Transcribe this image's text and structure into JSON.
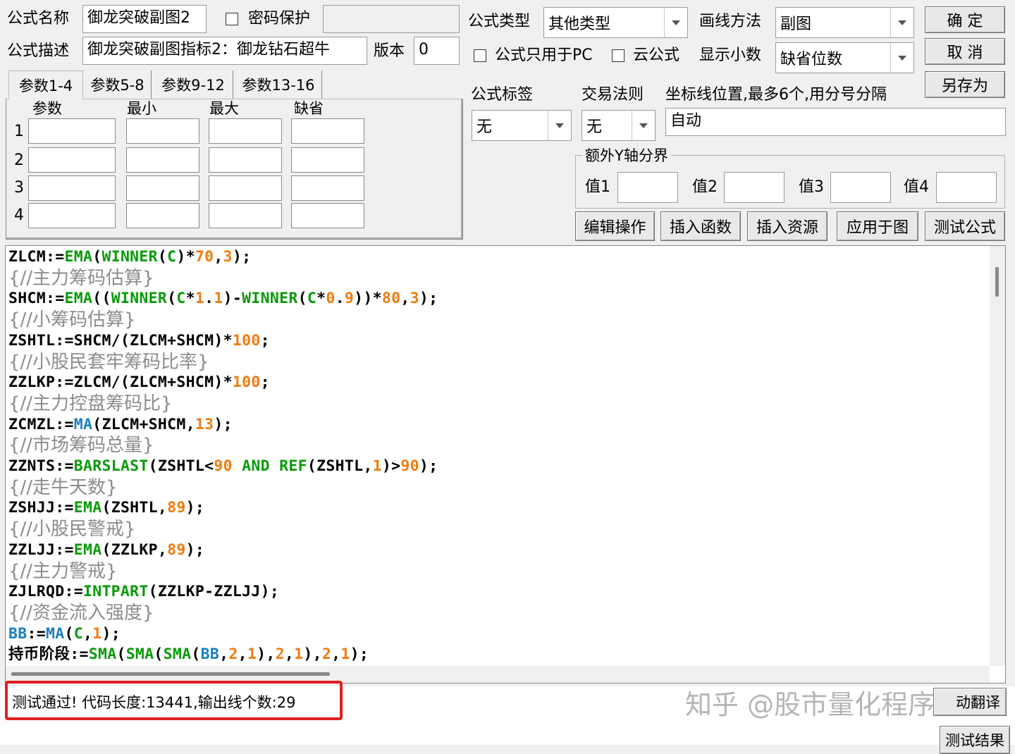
{
  "form": {
    "name_label": "公式名称",
    "name_value": "御龙突破副图2",
    "password_label": "密码保护",
    "desc_label": "公式描述",
    "desc_value": "御龙突破副图指标2：御龙钻石超牛",
    "version_label": "版本",
    "version_value": "0",
    "type_label": "公式类型",
    "type_value": "其他类型",
    "draw_label": "画线方法",
    "draw_value": "副图",
    "pc_only_label": "公式只用于PC",
    "cloud_label": "云公式",
    "decimal_label": "显示小数",
    "decimal_value": "缺省位数",
    "tag_label": "公式标签",
    "tag_value": "无",
    "trade_label": "交易法则",
    "trade_value": "无",
    "coord_label": "坐标线位置,最多6个,用分号分隔",
    "coord_value": "自动",
    "yaxis_group_label": "额外Y轴分界",
    "y_labels": [
      "值1",
      "值2",
      "值3",
      "值4"
    ]
  },
  "buttons": {
    "ok": "确  定",
    "cancel": "取  消",
    "save_as": "另存为",
    "edit_ops": "编辑操作",
    "insert_func": "插入函数",
    "insert_res": "插入资源",
    "apply_chart": "应用于图",
    "test_formula": "测试公式",
    "translate": "动翻译",
    "test_result": "测试结果"
  },
  "param_tabs": [
    "参数1-4",
    "参数5-8",
    "参数9-12",
    "参数13-16"
  ],
  "param_headers": [
    "参数",
    "最小",
    "最大",
    "缺省"
  ],
  "param_rows": [
    "1",
    "2",
    "3",
    "4"
  ],
  "code": [
    {
      "type": "code",
      "tokens": [
        [
          "id",
          "ZLCM:="
        ],
        [
          "fn",
          "EMA"
        ],
        [
          "op",
          "("
        ],
        [
          "fn",
          "WINNER"
        ],
        [
          "op",
          "("
        ],
        [
          "fn",
          "C"
        ],
        [
          "op",
          ")*"
        ],
        [
          "num",
          "70"
        ],
        [
          "op",
          ","
        ],
        [
          "num",
          "3"
        ],
        [
          "op",
          ");"
        ]
      ]
    },
    {
      "type": "comment",
      "text": "{//主力筹码估算}"
    },
    {
      "type": "code",
      "tokens": [
        [
          "id",
          "SHCM:="
        ],
        [
          "fn",
          "EMA"
        ],
        [
          "op",
          "(("
        ],
        [
          "fn",
          "WINNER"
        ],
        [
          "op",
          "("
        ],
        [
          "fn",
          "C"
        ],
        [
          "op",
          "*"
        ],
        [
          "num",
          "1"
        ],
        [
          "op",
          "."
        ],
        [
          "num",
          "1"
        ],
        [
          "op",
          ")-"
        ],
        [
          "fn",
          "WINNER"
        ],
        [
          "op",
          "("
        ],
        [
          "fn",
          "C"
        ],
        [
          "op",
          "*"
        ],
        [
          "num",
          "0"
        ],
        [
          "op",
          "."
        ],
        [
          "num",
          "9"
        ],
        [
          "op",
          "))*"
        ],
        [
          "num",
          "80"
        ],
        [
          "op",
          ","
        ],
        [
          "num",
          "3"
        ],
        [
          "op",
          ");"
        ]
      ]
    },
    {
      "type": "comment",
      "text": "{//小筹码估算}"
    },
    {
      "type": "code",
      "tokens": [
        [
          "id",
          "ZSHTL:=SHCM/(ZLCM+SHCM)*"
        ],
        [
          "num",
          "100"
        ],
        [
          "op",
          ";"
        ]
      ]
    },
    {
      "type": "comment",
      "text": "{//小股民套牢筹码比率}"
    },
    {
      "type": "code",
      "tokens": [
        [
          "id",
          "ZZLKP:=ZLCM/(ZLCM+SHCM)*"
        ],
        [
          "num",
          "100"
        ],
        [
          "op",
          ";"
        ]
      ]
    },
    {
      "type": "comment",
      "text": "{//主力控盘筹码比}"
    },
    {
      "type": "code",
      "tokens": [
        [
          "id",
          "ZCMZL:="
        ],
        [
          "fnb",
          "MA"
        ],
        [
          "op",
          "(ZLCM+SHCM,"
        ],
        [
          "num",
          "13"
        ],
        [
          "op",
          ");"
        ]
      ]
    },
    {
      "type": "comment",
      "text": "{//市场筹码总量}"
    },
    {
      "type": "code",
      "tokens": [
        [
          "id",
          "ZZNTS:="
        ],
        [
          "fn",
          "BARSLAST"
        ],
        [
          "op",
          "(ZSHTL<"
        ],
        [
          "num",
          "90"
        ],
        [
          "op",
          " "
        ],
        [
          "kw",
          "AND"
        ],
        [
          "op",
          " "
        ],
        [
          "fn",
          "REF"
        ],
        [
          "op",
          "(ZSHTL,"
        ],
        [
          "num",
          "1"
        ],
        [
          "op",
          ")>"
        ],
        [
          "num",
          "90"
        ],
        [
          "op",
          ");"
        ]
      ]
    },
    {
      "type": "comment",
      "text": "{//走牛天数}"
    },
    {
      "type": "code",
      "tokens": [
        [
          "id",
          "ZSHJJ:="
        ],
        [
          "fn",
          "EMA"
        ],
        [
          "op",
          "(ZSHTL,"
        ],
        [
          "num",
          "89"
        ],
        [
          "op",
          ");"
        ]
      ]
    },
    {
      "type": "comment",
      "text": "{//小股民警戒}"
    },
    {
      "type": "code",
      "tokens": [
        [
          "id",
          "ZZLJJ:="
        ],
        [
          "fn",
          "EMA"
        ],
        [
          "op",
          "(ZZLKP,"
        ],
        [
          "num",
          "89"
        ],
        [
          "op",
          ");"
        ]
      ]
    },
    {
      "type": "comment",
      "text": "{//主力警戒}"
    },
    {
      "type": "code",
      "tokens": [
        [
          "id",
          "ZJLRQD:="
        ],
        [
          "fn",
          "INTPART"
        ],
        [
          "op",
          "(ZZLKP-ZZLJJ);"
        ]
      ]
    },
    {
      "type": "comment",
      "text": "{//资金流入强度}"
    },
    {
      "type": "code",
      "tokens": [
        [
          "var",
          "BB"
        ],
        [
          "op",
          ":="
        ],
        [
          "fnb",
          "MA"
        ],
        [
          "op",
          "("
        ],
        [
          "fn",
          "C"
        ],
        [
          "op",
          ","
        ],
        [
          "num",
          "1"
        ],
        [
          "op",
          ");"
        ]
      ]
    },
    {
      "type": "code",
      "tokens": [
        [
          "id",
          "持币阶段:="
        ],
        [
          "fn",
          "SMA"
        ],
        [
          "op",
          "("
        ],
        [
          "fn",
          "SMA"
        ],
        [
          "op",
          "("
        ],
        [
          "fn",
          "SMA"
        ],
        [
          "op",
          "("
        ],
        [
          "var",
          "BB"
        ],
        [
          "op",
          ","
        ],
        [
          "num",
          "2"
        ],
        [
          "op",
          ","
        ],
        [
          "num",
          "1"
        ],
        [
          "op",
          "),"
        ],
        [
          "num",
          "2"
        ],
        [
          "op",
          ","
        ],
        [
          "num",
          "1"
        ],
        [
          "op",
          "),"
        ],
        [
          "num",
          "2"
        ],
        [
          "op",
          ","
        ],
        [
          "num",
          "1"
        ],
        [
          "op",
          ");"
        ]
      ]
    }
  ],
  "status": {
    "message": "测试通过! 代码长度:13441,输出线个数:29",
    "watermark": "知乎 @股市量化程序猿"
  },
  "colors": {
    "function": "#0a9a0a",
    "number": "#f07c10",
    "ma_function": "#1a7fc0",
    "comment": "#8c8c8c",
    "highlight_box": "#e02020"
  }
}
